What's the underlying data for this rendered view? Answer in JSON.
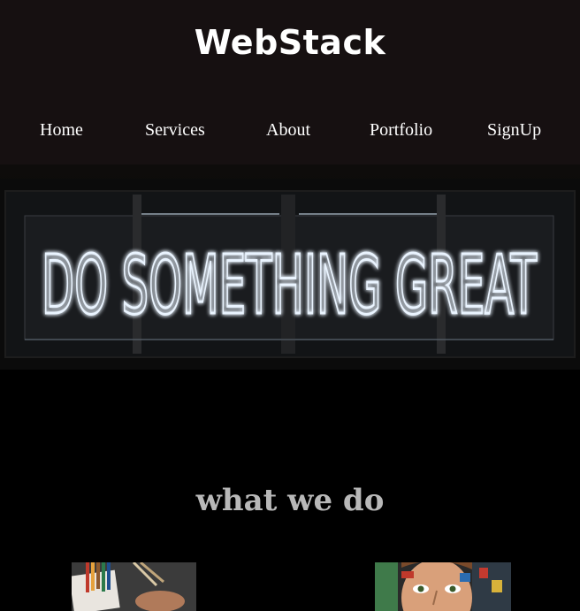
{
  "brand": {
    "title": "WebStack"
  },
  "nav": {
    "items": [
      {
        "label": "Home"
      },
      {
        "label": "Services"
      },
      {
        "label": "About"
      },
      {
        "label": "Portfolio"
      },
      {
        "label": "SignUp"
      }
    ]
  },
  "hero": {
    "sign_text": "DO SOMETHING GREAT"
  },
  "section": {
    "title": "what we do"
  },
  "colors": {
    "header_bg": "#161011",
    "page_bg": "#000000",
    "title_color": "#b8b8b8",
    "neon": "#e8f2ff"
  }
}
